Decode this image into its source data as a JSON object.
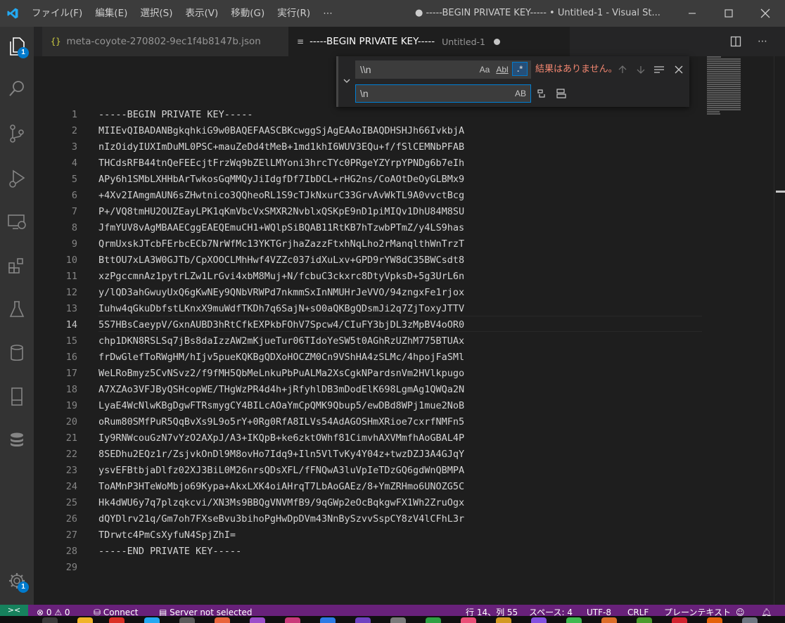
{
  "titlebar": {
    "menu": [
      "ファイル(F)",
      "編集(E)",
      "選択(S)",
      "表示(V)",
      "移動(G)",
      "実行(R)",
      "⋯"
    ],
    "window_title": "● -----BEGIN PRIVATE KEY----- • Untitled-1 - Visual St..."
  },
  "activitybar": {
    "explorer_badge": "1",
    "settings_badge": "1"
  },
  "tabs": [
    {
      "icon": "{}",
      "label": "meta-coyote-270802-9ec1f4b8147b.json"
    },
    {
      "label": "-----BEGIN PRIVATE KEY-----",
      "description": "Untitled-1"
    }
  ],
  "find": {
    "search_value": "\\\\n",
    "replace_value": "\\n",
    "match_case": "Aa",
    "whole_word": "Abl",
    "regex": ".*",
    "preserve_case": "AB",
    "no_results": "結果はありません。"
  },
  "editor": {
    "active_line": 14,
    "lines": [
      "-----BEGIN PRIVATE KEY-----",
      "MIIEvQIBADANBgkqhkiG9w0BAQEFAASCBKcwggSjAgEAAoIBAQDHSHJh66IvkbjA",
      "nIzOidyIUXImDuML0PSC+mauZeDd4tMeB+1md1khI6WUV3EQu+f/fSlCEMNbPFAB",
      "THCdsRFB44tnQeFEEcjtFrzWq9bZElLMYoni3hrcTYc0PRgeYZYrpYPNDg6b7eIh",
      "APy6h1SMbLXHHbArTwkosGqMMQyJiIdgfDf7IbDCL+rHG2ns/CoAOtDeOyGLBMx9",
      "+4Xv2IAmgmAUN6sZHwtnico3QQheoRL1S9cTJkNxurC33GrvAvWkTL9A0vvctBcg",
      "P+/VQ8tmHU2OUZEayLPK1qKmVbcVxSMXR2NvblxQSKpE9nD1piMIQv1DhU84M8SU",
      "JfmYUV8vAgMBAAECggEAEQEmuCH1+WQlpSiBQAB11RtKB7hTzwbPTmZ/y4LS9has",
      "QrmUxskJTcbFErbcECb7NrWfMc13YKTGrjhaZazzFtxhNqLho2rManqlthWnTrzT",
      "BttOU7xLA3W0GJTb/CpXOOCLMhHwf4VZZc037idXuLxv+GPD9rYW8dC35BWCsdt8",
      "xzPgccmnAz1pytrLZw1LrGvi4xbM8Muj+N/fcbuC3ckxrc8DtyVpksD+5g3UrL6n",
      "y/lQD3ahGwuyUxQ6gKwNEy9QNbVRWPd7nkmmSxInNMUHrJeVVO/94zngxFe1rjox",
      "Iuhw4qGkuDbfstLKnxX9muWdfTKDh7q6SajN+sO0aQKBgQDsmJi2q7ZjToxyJTTV",
      "5S7HBsCaeypV/GxnAUBD3hRtCfkEXPkbFOhV7Spcw4/CIuFY3bjDL3zMpBV4oOR0",
      "chp1DKN8RSLSq7jBs8daIzzAW2mKjueTur06TIdoYeSW5t0AGhRzUZhM775BTUAx",
      "frDwGlefToRWgHM/hIjv5pueKQKBgQDXoHOCZM0Cn9VShHA4zSLMc/4hpojFaSMl",
      "WeLRoBmyz5CvNSvz2/f9fMH5QbMeLnkuPbPuALMa2XsCgkNPardsnVm2HVlkpugo",
      "A7XZAo3VFJByQSHcopWE/THgWzPR4d4h+jRfyhlDB3mDodElK698LgmAg1QWQa2N",
      "LyaE4WcNlwKBgDgwFTRsmygCY4BILcAOaYmCpQMK9Qbup5/ewDBd8WPj1mue2NoB",
      "oRum80SMfPuR5QqBvXs9L9o5rY+0Rg0RfA8ILVs54AdAGOSHmXRioe7cxrfNMFn5",
      "Iy9RNWcouGzN7vYzO2AXpJ/A3+IKQpB+ke6zktOWhf81CimvhAXVMmfhAoGBAL4P",
      "8SEDhu2EQz1r/ZsjvkOnDl9M8ovHo7Idq9+Iln5VlTvKy4Y04z+twzDZJ3A4GJqY",
      "ysvEFBtbjaDlfz02XJ3BiL0M26nrsQDsXFL/fFNQwA3luVpIeTDzGQ6gdWnQBMPA",
      "ToAMnP3HTeWoMbjo69Kypa+AkxLXK4oiAHrqT7LbAoGAEz/8+YmZRHmo6UNOZG5C",
      "Hk4dWU6y7q7plzqkcvi/XN3Ms9BBQgVNVMfB9/9qGWp2eOcBqkgwFX1Wh2ZruOgx",
      "dQYDlrv21q/Gm7oh7FXseBvu3bihoPgHwDpDVm43NnBySzvvSspCY8zV4lCFhL3r",
      "TDrwtc4PmCsXyfuN4SpjZhI=",
      "-----END PRIVATE KEY-----",
      ""
    ]
  },
  "statusbar": {
    "remote": "><",
    "problems": "⊗ 0 ⚠ 0",
    "connect": "Connect",
    "server": "Server not selected",
    "position": "行 14、列 55",
    "spaces": "スペース: 4",
    "encoding": "UTF-8",
    "eol": "CRLF",
    "language": "プレーンテキスト"
  },
  "colors": {
    "statusbar": "#68217a",
    "accent": "#007acc",
    "no_results": "#f48771"
  }
}
